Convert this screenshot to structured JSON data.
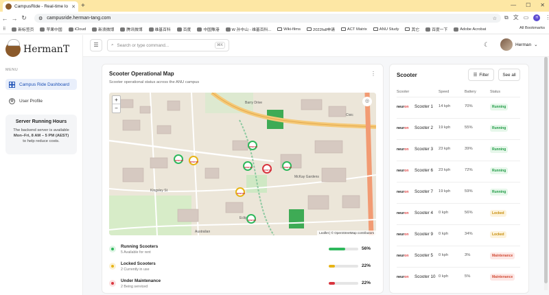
{
  "browser": {
    "tab_title": "CampusRide - Real-time lo",
    "url": "campusride.herman-tang.com",
    "bookmarks": [
      "新标签页",
      "苹果中国",
      "iCloud",
      "新浪微博",
      "腾讯微博",
      "维基百科",
      "百度",
      "中国豫港",
      "W 孙中山 - 维基百科...",
      "Wiki-films",
      "2022fall申请",
      "ACT Matrix",
      "ANU Study",
      "其它",
      "百度一下",
      "Adobe Acrobat"
    ],
    "all_bookmarks": "All Bookmarks"
  },
  "sidebar": {
    "logo_text": "HermanT",
    "menu_label": "MENU",
    "items": [
      {
        "label": "Campus Ride Dashboard",
        "icon": "dashboard-icon"
      },
      {
        "label": "User Profile",
        "icon": "user-icon"
      }
    ],
    "info_card": {
      "title": "Server Running Hours",
      "line1": "The backend server is available",
      "line2": "Mon–Fri, 8 AM – 5 PM (AEST)",
      "line3": "to help reduce costs."
    }
  },
  "topbar": {
    "search_placeholder": "Search or type command...",
    "shortcut": "⌘K",
    "user_name": "Herman"
  },
  "map_card": {
    "title": "Scooter Operational Map",
    "subtitle": "Scooter operational status across the ANU campus",
    "attribution": "Leaflet | © OpenStreetMap contributors",
    "zoom_in": "+",
    "zoom_out": "−",
    "places": [
      "Barry Drive",
      "Civic",
      "McKay Gardens",
      "Kingsley St",
      "Eclipse",
      "Australian"
    ],
    "marker_label": "neuron",
    "legend": [
      {
        "name": "Running Scooters",
        "sub": "5 Available for rent",
        "pct_label": "56%",
        "fraction": 0.56,
        "color": "#2eb85c",
        "dot_bg": "#dff5e5"
      },
      {
        "name": "Locked Scooters",
        "sub": "2 Currently in use",
        "pct_label": "22%",
        "fraction": 0.22,
        "color": "#e7b416",
        "dot_bg": "#fbf1d3"
      },
      {
        "name": "Under Maintenance",
        "sub": "2 Being serviced",
        "pct_label": "22%",
        "fraction": 0.22,
        "color": "#d9343e",
        "dot_bg": "#fbe1e1"
      }
    ]
  },
  "list_card": {
    "title": "Scooter",
    "filter_label": "Filter",
    "see_all_label": "See all",
    "columns": {
      "scooter": "Scooter",
      "speed": "Speed",
      "battery": "Battery",
      "status": "Status"
    },
    "brand_a": "neur",
    "brand_b": "on",
    "rows": [
      {
        "name": "Scooter 1",
        "speed": "14 kph",
        "battery": "70%",
        "status": "Running",
        "kind": "running"
      },
      {
        "name": "Scooter 2",
        "speed": "19 kph",
        "battery": "55%",
        "status": "Running",
        "kind": "running"
      },
      {
        "name": "Scooter 3",
        "speed": "23 kph",
        "battery": "39%",
        "status": "Running",
        "kind": "running"
      },
      {
        "name": "Scooter 6",
        "speed": "23 kph",
        "battery": "72%",
        "status": "Running",
        "kind": "running"
      },
      {
        "name": "Scooter 7",
        "speed": "19 kph",
        "battery": "59%",
        "status": "Running",
        "kind": "running"
      },
      {
        "name": "Scooter 4",
        "speed": "0 kph",
        "battery": "56%",
        "status": "Locked",
        "kind": "locked"
      },
      {
        "name": "Scooter 9",
        "speed": "0 kph",
        "battery": "34%",
        "status": "Locked",
        "kind": "locked"
      },
      {
        "name": "Scooter 5",
        "speed": "0 kph",
        "battery": "3%",
        "status": "Maintenance",
        "kind": "maintenance"
      },
      {
        "name": "Scooter 10",
        "speed": "0 kph",
        "battery": "5%",
        "status": "Maintenance",
        "kind": "maintenance"
      }
    ]
  }
}
